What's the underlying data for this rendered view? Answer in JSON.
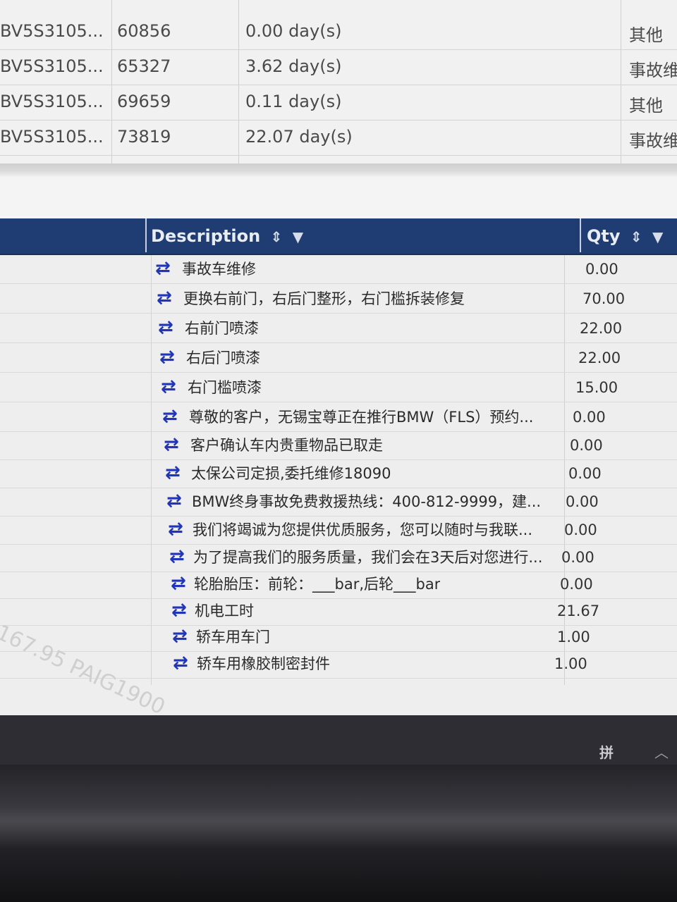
{
  "top_table": {
    "rows": [
      {
        "vin": "BV5S3105...",
        "mileage": "60856",
        "duration": "0.00 day(s)",
        "type": "其他"
      },
      {
        "vin": "BV5S3105...",
        "mileage": "65327",
        "duration": "3.62 day(s)",
        "type": "事故维"
      },
      {
        "vin": "BV5S3105...",
        "mileage": "69659",
        "duration": "0.11 day(s)",
        "type": "其他"
      },
      {
        "vin": "BV5S3105...",
        "mileage": "73819",
        "duration": "22.07 day(s)",
        "type": "事故维"
      }
    ]
  },
  "detail_table": {
    "headers": {
      "description": "Description",
      "qty": "Qty"
    },
    "sort_icon": "sort-icon",
    "filter_icon": "filter-icon",
    "row_icon": "transfer-arrows-icon",
    "rows": [
      {
        "description": "事故车维修",
        "qty": "0.00"
      },
      {
        "description": "更换右前门，右后门整形，右门槛拆装修复",
        "qty": "70.00"
      },
      {
        "description": "右前门喷漆",
        "qty": "22.00"
      },
      {
        "description": "右后门喷漆",
        "qty": "22.00"
      },
      {
        "description": "右门槛喷漆",
        "qty": "15.00"
      },
      {
        "description": "尊敬的客户，无锡宝尊正在推行BMW（FLS）预约...",
        "qty": "0.00"
      },
      {
        "description": "客户确认车内贵重物品已取走",
        "qty": "0.00"
      },
      {
        "description": "太保公司定损,委托维修18090",
        "qty": "0.00"
      },
      {
        "description": "BMW终身事故免费救援热线：400-812-9999，建...",
        "qty": "0.00"
      },
      {
        "description": "我们将竭诚为您提供优质服务，您可以随时与我联...",
        "qty": "0.00"
      },
      {
        "description": "为了提高我们的服务质量，我们会在3天后对您进行...",
        "qty": "0.00"
      },
      {
        "description": "轮胎胎压：前轮：___bar,后轮___bar",
        "qty": "0.00"
      },
      {
        "description": "机电工时",
        "qty": "21.67"
      },
      {
        "description": "轿车用车门",
        "qty": "1.00"
      },
      {
        "description": "轿车用橡胶制密封件",
        "qty": "1.00"
      }
    ]
  },
  "watermark": "167.95  PAIG1900",
  "taskbar": {
    "ime_label": "拼",
    "tray_chevron_icon": "chevron-up-icon"
  }
}
